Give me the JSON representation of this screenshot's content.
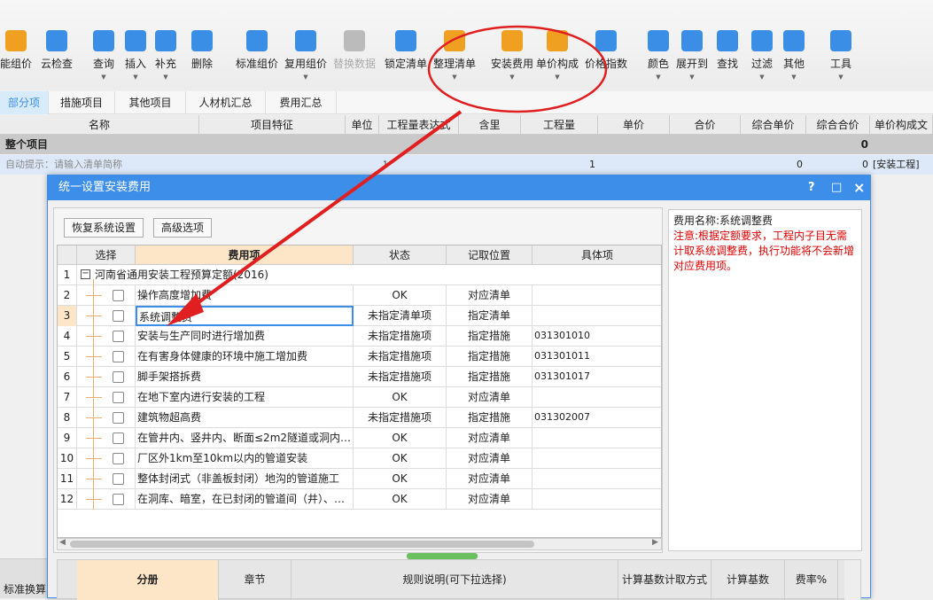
{
  "toolbar": {
    "items": [
      {
        "label": "能组价",
        "icon": "smart-price-icon",
        "color": "#f0a020",
        "dd": false
      },
      {
        "label": "云检查",
        "icon": "cloud-check-icon",
        "color": "#3a8ee6",
        "dd": false
      },
      {
        "label": "查询",
        "icon": "search-icon",
        "color": "#3a8ee6",
        "dd": true
      },
      {
        "label": "插入",
        "icon": "insert-icon",
        "color": "#3a8ee6",
        "dd": true
      },
      {
        "label": "补充",
        "icon": "supplement-icon",
        "color": "#3a8ee6",
        "dd": true
      },
      {
        "label": "删除",
        "icon": "delete-icon",
        "color": "#3a8ee6",
        "dd": false
      },
      {
        "label": "标准组价",
        "icon": "standard-price-icon",
        "color": "#3a8ee6",
        "dd": false
      },
      {
        "label": "复用组价",
        "icon": "reuse-price-icon",
        "color": "#3a8ee6",
        "dd": true
      },
      {
        "label": "替换数据",
        "icon": "replace-data-icon",
        "color": "#bbbbbb",
        "dd": false,
        "disabled": true
      },
      {
        "label": "锁定清单",
        "icon": "lock-icon",
        "color": "#3a8ee6",
        "dd": false
      },
      {
        "label": "整理清单",
        "icon": "organize-list-icon",
        "color": "#f0a020",
        "dd": true
      },
      {
        "label": "安装费用",
        "icon": "install-fee-icon",
        "color": "#f0a020",
        "dd": true
      },
      {
        "label": "单价构成",
        "icon": "unit-price-icon",
        "color": "#f0a020",
        "dd": true
      },
      {
        "label": "价格指数",
        "icon": "price-index-icon",
        "color": "#3a8ee6",
        "dd": false
      },
      {
        "label": "颜色",
        "icon": "color-bucket-icon",
        "color": "#3a8ee6",
        "dd": true
      },
      {
        "label": "展开到",
        "icon": "expand-icon",
        "color": "#3a8ee6",
        "dd": true
      },
      {
        "label": "查找",
        "icon": "binoculars-icon",
        "color": "#3a8ee6",
        "dd": false
      },
      {
        "label": "过滤",
        "icon": "filter-icon",
        "color": "#3a8ee6",
        "dd": true
      },
      {
        "label": "其他",
        "icon": "grid-icon",
        "color": "#3a8ee6",
        "dd": true
      },
      {
        "label": "工具",
        "icon": "tools-icon",
        "color": "#3a8ee6",
        "dd": true
      }
    ]
  },
  "tabs": [
    "部分项",
    "措施项目",
    "其他项目",
    "人材机汇总",
    "费用汇总"
  ],
  "grid": {
    "headers": [
      "名称",
      "项目特征",
      "单位",
      "工程量表达式",
      "含里",
      "工程量",
      "单价",
      "合价",
      "综合单价",
      "综合合价",
      "单价构成文"
    ],
    "group_row": {
      "name": "整个项目",
      "total": "0"
    },
    "input_row": {
      "name": "自动提示：请输入清单简称",
      "expr": "1",
      "qty": "1",
      "comp_price": "0",
      "comp_total": "0",
      "template": "[安装工程]"
    }
  },
  "dialog": {
    "title": "统一设置安装费用",
    "help": "?",
    "maximize": "□",
    "close": "×",
    "buttons": {
      "restore": "恢复系统设置",
      "advanced": "高级选项"
    },
    "headers": [
      "选择",
      "费用项",
      "状态",
      "记取位置",
      "具体项"
    ],
    "group": "河南省通用安装工程预算定额(2016)",
    "rows": [
      {
        "n": "2",
        "name": "操作高度增加费",
        "status": "OK",
        "pos": "对应清单",
        "item": ""
      },
      {
        "n": "3",
        "name": "系统调整费",
        "status": "未指定清单项",
        "pos": "指定清单",
        "item": ""
      },
      {
        "n": "4",
        "name": "安装与生产同时进行增加费",
        "status": "未指定措施项",
        "pos": "指定措施",
        "item": "031301010"
      },
      {
        "n": "5",
        "name": "在有害身体健康的环境中施工增加费",
        "status": "未指定措施项",
        "pos": "指定措施",
        "item": "031301011"
      },
      {
        "n": "6",
        "name": "脚手架搭拆费",
        "status": "未指定措施项",
        "pos": "指定措施",
        "item": "031301017"
      },
      {
        "n": "7",
        "name": "在地下室内进行安装的工程",
        "status": "OK",
        "pos": "对应清单",
        "item": ""
      },
      {
        "n": "8",
        "name": "建筑物超高费",
        "status": "未指定措施项",
        "pos": "指定措施",
        "item": "031302007"
      },
      {
        "n": "9",
        "name": "在管井内、竖井内、断面≤2m2隧道或洞内…",
        "status": "OK",
        "pos": "对应清单",
        "item": ""
      },
      {
        "n": "10",
        "name": "厂区外1km至10km以内的管道安装",
        "status": "OK",
        "pos": "对应清单",
        "item": ""
      },
      {
        "n": "11",
        "name": "整体封闭式（非盖板封闭）地沟的管道施工",
        "status": "OK",
        "pos": "对应清单",
        "item": ""
      },
      {
        "n": "12",
        "name": "在洞库、暗室，在已封闭的管道间（井）、…",
        "status": "OK",
        "pos": "对应清单",
        "item": ""
      }
    ],
    "info": {
      "name": "费用名称:系统调整费",
      "note": "注意:根据定额要求，工程内子目无需计取系统调整费，执行功能将不会新增对应费用项。"
    },
    "bottom_headers": [
      "分册",
      "章节",
      "规则说明(可下拉选择)",
      "计算基数计取方式",
      "计算基数",
      "费率%"
    ]
  },
  "left_bottom_tab": "标准换算",
  "colors": {
    "accent": "#3c8ee8",
    "annotation": "#e02020",
    "note": "#e00000"
  }
}
